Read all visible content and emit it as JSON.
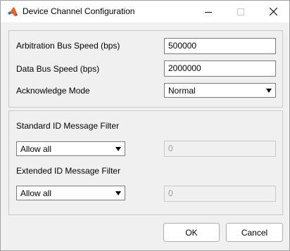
{
  "window": {
    "title": "Device Channel Configuration",
    "icon": "matlab-icon",
    "controls": {
      "minimize": "minimize-icon",
      "maximize": "maximize-icon",
      "close": "close-icon"
    }
  },
  "bus_settings": {
    "arbitration_label": "Arbitration Bus Speed (bps)",
    "arbitration_value": "500000",
    "data_label": "Data Bus Speed (bps)",
    "data_value": "2000000",
    "ack_label": "Acknowledge Mode",
    "ack_value": "Normal"
  },
  "filters": {
    "standard_label": "Standard ID Message Filter",
    "standard_mode": "Allow all",
    "standard_value": "0",
    "extended_label": "Extended ID Message Filter",
    "extended_mode": "Allow all",
    "extended_value": "0"
  },
  "actions": {
    "ok_label": "OK",
    "cancel_label": "Cancel"
  }
}
